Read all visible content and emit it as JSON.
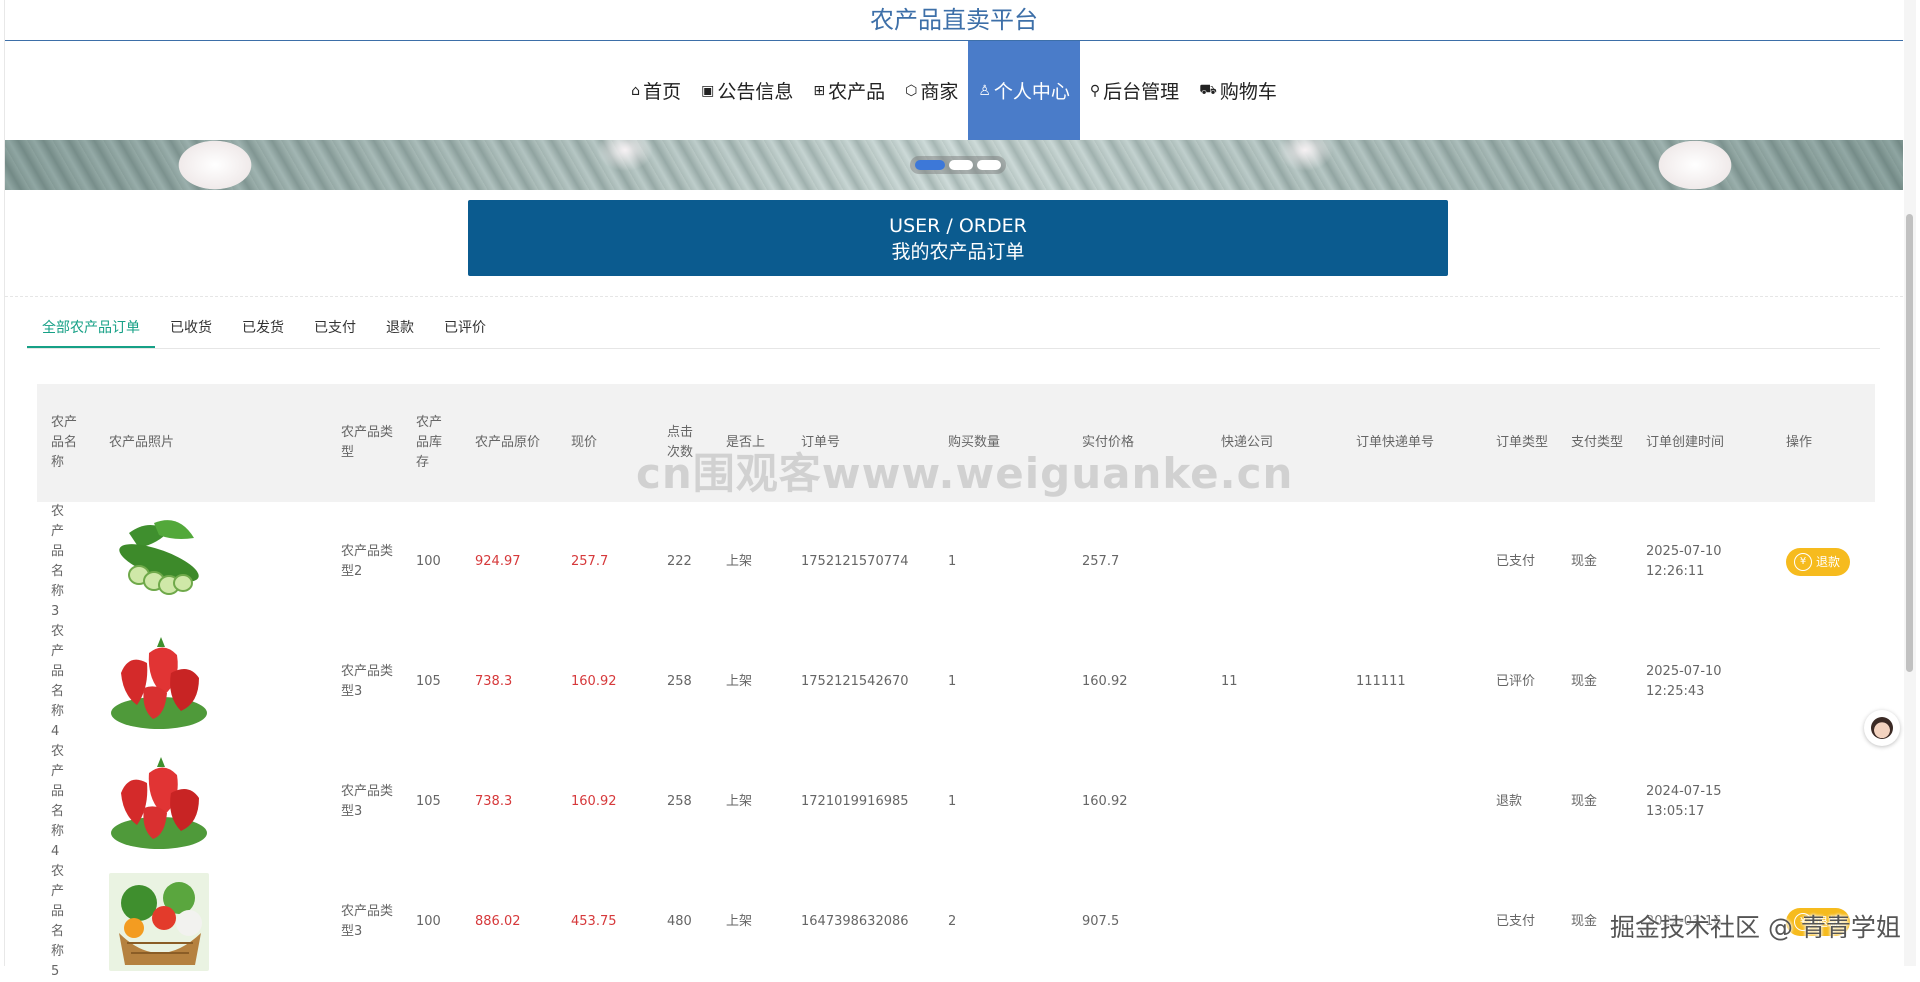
{
  "site": {
    "title": "农产品直卖平台"
  },
  "nav": {
    "items": [
      {
        "icon": "home-icon",
        "glyph": "⌂",
        "label": "首页"
      },
      {
        "icon": "notice-icon",
        "glyph": "▣",
        "label": "公告信息"
      },
      {
        "icon": "gift-icon",
        "glyph": "⊞",
        "label": "农产品"
      },
      {
        "icon": "shop-icon",
        "glyph": "⬡",
        "label": "商家"
      },
      {
        "icon": "user-icon",
        "glyph": "♙",
        "label": "个人中心"
      },
      {
        "icon": "link-icon",
        "glyph": "⚲",
        "label": "后台管理"
      },
      {
        "icon": "cart-icon",
        "glyph": "⛟",
        "label": "购物车"
      }
    ],
    "active_index": 4
  },
  "carousel": {
    "slides": 3,
    "active": 1
  },
  "order_header": {
    "en": "USER / ORDER",
    "cn": "我的农产品订单"
  },
  "tabs": [
    "全部农产品订单",
    "已收货",
    "已发货",
    "已支付",
    "退款",
    "已评价"
  ],
  "table": {
    "headers": [
      "农产品名称",
      "农产品照片",
      "农产品类型",
      "农产品库存",
      "农产品原价",
      "现价",
      "点击次数",
      "是否上",
      "订单号",
      "购买数量",
      "实付价格",
      "快递公司",
      "订单快递单号",
      "订单类型",
      "支付类型",
      "订单创建时间",
      "操作"
    ],
    "rows": [
      {
        "name": "农产品名称3",
        "photo": "cucumber",
        "type": "农产品类型2",
        "stock": "100",
        "orig_price": "924.97",
        "price": "257.7",
        "clicks": "222",
        "status": "上架",
        "order_no": "1752121570774",
        "qty": "1",
        "paid": "257.7",
        "express": "",
        "express_no": "",
        "order_type": "已支付",
        "pay_type": "现金",
        "created": "2025-07-10 12:26:11",
        "action": "退款"
      },
      {
        "name": "农产品名称4",
        "photo": "strawberry",
        "type": "农产品类型3",
        "stock": "105",
        "orig_price": "738.3",
        "price": "160.92",
        "clicks": "258",
        "status": "上架",
        "order_no": "1752121542670",
        "qty": "1",
        "paid": "160.92",
        "express": "11",
        "express_no": "111111",
        "order_type": "已评价",
        "pay_type": "现金",
        "created": "2025-07-10 12:25:43",
        "action": ""
      },
      {
        "name": "农产品名称4",
        "photo": "strawberry",
        "type": "农产品类型3",
        "stock": "105",
        "orig_price": "738.3",
        "price": "160.92",
        "clicks": "258",
        "status": "上架",
        "order_no": "1721019916985",
        "qty": "1",
        "paid": "160.92",
        "express": "",
        "express_no": "",
        "order_type": "退款",
        "pay_type": "现金",
        "created": "2024-07-15 13:05:17",
        "action": ""
      },
      {
        "name": "农产品名称5",
        "photo": "vegetables",
        "type": "农产品类型3",
        "stock": "100",
        "orig_price": "886.02",
        "price": "453.75",
        "clicks": "480",
        "status": "上架",
        "order_no": "1647398632086",
        "qty": "2",
        "paid": "907.5",
        "express": "",
        "express_no": "",
        "order_type": "已支付",
        "pay_type": "现金",
        "created": "2022-03-16",
        "action": "退款"
      }
    ]
  },
  "watermarks": {
    "center": "cn围观客www.weiguanke.cn",
    "corner": "掘金技术社区 @ 青青学姐"
  },
  "colors": {
    "nav_active": "#4a7cc9",
    "header_bg": "#0b5b8f",
    "tab_active": "#16a086",
    "price_red": "#d6393b",
    "button_yellow": "#f6bb1e",
    "title_blue": "#3d6fa8"
  }
}
